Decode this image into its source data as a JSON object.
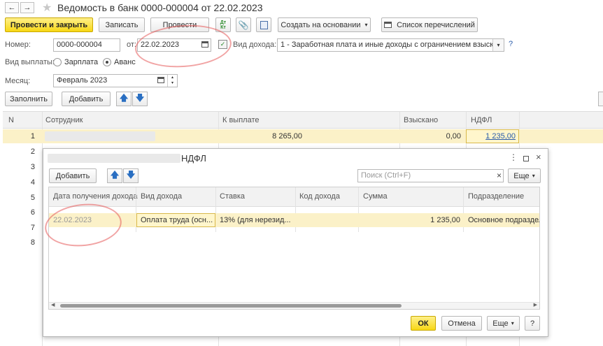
{
  "window": {
    "title": "Ведомость в банк 0000-000004 от 22.02.2023"
  },
  "toolbar": {
    "post_close_label": "Провести и закрыть",
    "save_label": "Записать",
    "post_label": "Провести",
    "dtkt_label": "Дт Кт",
    "create_based_label": "Создать на основании",
    "list_transfers_label": "Список перечислений"
  },
  "form": {
    "number_label": "Номер:",
    "number_value": "0000-000004",
    "date_label": "от:",
    "date_value": "22.02.2023",
    "income_type_label": "Вид дохода:",
    "income_type_value": "1 - Заработная плата и иные доходы с ограничением взыскания",
    "help_label": "?",
    "payment_type_label": "Вид выплаты:",
    "payment_options": [
      "Зарплата",
      "Аванс"
    ],
    "payment_selected": "Аванс",
    "month_label": "Месяц:",
    "month_value": "Февраль 2023"
  },
  "grid_toolbar": {
    "fill_label": "Заполнить",
    "add_label": "Добавить"
  },
  "grid": {
    "columns": [
      "N",
      "Сотрудник",
      "К выплате",
      "Взыскано",
      "НДФЛ"
    ],
    "rows": [
      {
        "n": "1",
        "to_pay": "8 265,00",
        "withheld": "0,00",
        "ndfl": "1 235,00"
      },
      {
        "n": "2"
      },
      {
        "n": "3"
      },
      {
        "n": "4"
      },
      {
        "n": "5"
      },
      {
        "n": "6"
      },
      {
        "n": "7"
      },
      {
        "n": "8"
      }
    ]
  },
  "dialog": {
    "title": "НДФЛ",
    "add_label": "Добавить",
    "search_placeholder": "Поиск (Ctrl+F)",
    "more_label": "Еще",
    "columns": [
      "Дата получения дохода",
      "Вид дохода",
      "Ставка",
      "Код дохода",
      "Сумма",
      "Подразделение"
    ],
    "row": {
      "date": "22.02.2023",
      "income_type": "Оплата труда (осн...",
      "rate": "13% (для нерезид...",
      "code": "",
      "sum": "1 235,00",
      "division": "Основное подраздел..."
    },
    "ok_label": "ОК",
    "cancel_label": "Отмена",
    "footer_more_label": "Еще",
    "help_label": "?"
  },
  "colors": {
    "accent_yellow": "#f7d715",
    "selected_row": "#fbf1c8",
    "link_blue": "#2a5caa",
    "annotation_red": "#e65a5a"
  }
}
